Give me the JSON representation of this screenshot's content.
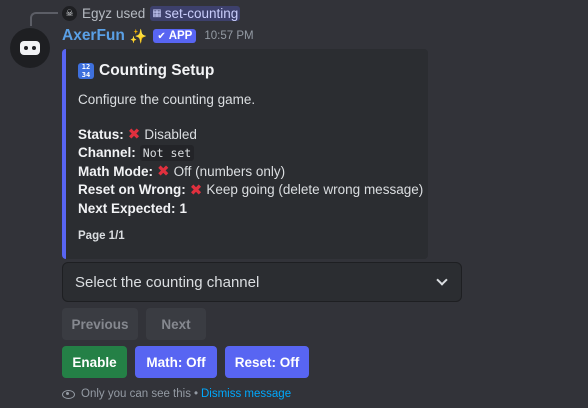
{
  "reply": {
    "user": "Egyz",
    "used_text": "used",
    "command": "set-counting"
  },
  "message": {
    "username": "AxerFun",
    "sparkle": "✨",
    "badge": "APP",
    "timestamp": "10:57 PM"
  },
  "embed": {
    "title_icon": "1234",
    "title": "Counting Setup",
    "description": "Configure the counting game.",
    "accent_color": "#5865f2",
    "fields": {
      "status_label": "Status:",
      "status_value": "Disabled",
      "channel_label": "Channel:",
      "channel_value": "Not set",
      "math_label": "Math Mode:",
      "math_value": "Off (numbers only)",
      "reset_label": "Reset on Wrong:",
      "reset_value": "Keep going (delete wrong message)",
      "next_label": "Next Expected:",
      "next_value": "1"
    },
    "footer": "Page 1/1"
  },
  "select": {
    "placeholder": "Select the counting channel"
  },
  "buttons": {
    "previous": "Previous",
    "next": "Next",
    "enable": "Enable",
    "math": "Math: Off",
    "reset": "Reset: Off"
  },
  "ephemeral": {
    "notice": "Only you can see this",
    "separator": "•",
    "dismiss": "Dismiss message"
  },
  "colors": {
    "background": "#323339",
    "blurple": "#5865f2",
    "green": "#248046",
    "error_red": "#e0303e",
    "link": "#00a8fc"
  }
}
